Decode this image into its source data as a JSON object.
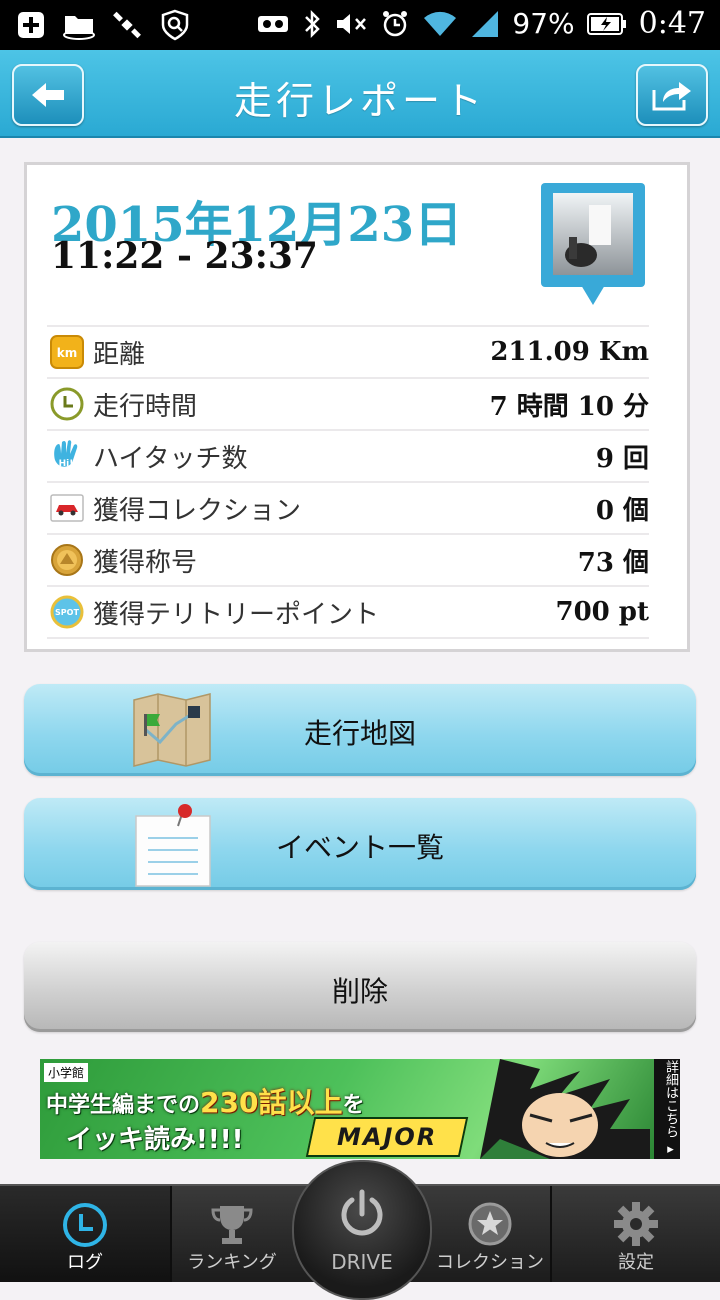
{
  "status_bar": {
    "battery": "97%",
    "time": "0:47",
    "icons": [
      "plus-icon",
      "folder-sync-icon",
      "satellite-icon",
      "security-shield-icon",
      "vr-icon",
      "bluetooth-icon",
      "mute-icon",
      "alarm-icon",
      "wifi-icon",
      "signal-icon",
      "battery-icon"
    ]
  },
  "header": {
    "title": "走行レポート",
    "back_icon": "back-arrow-icon",
    "share_icon": "share-icon"
  },
  "report": {
    "date": "2015年12月23日",
    "time_range": "11:22 - 23:37",
    "rows": [
      {
        "label": "距離",
        "value": "211.09 Km",
        "icon": "km-icon",
        "icon_text": "km"
      },
      {
        "label": "走行時間",
        "value": "7 時間 10 分",
        "icon": "clock-icon"
      },
      {
        "label": "ハイタッチ数",
        "value": "9 回",
        "icon": "hi-hand-icon",
        "icon_text": "Hi!"
      },
      {
        "label": "獲得コレクション",
        "value": "0 個",
        "icon": "car-card-icon"
      },
      {
        "label": "獲得称号",
        "value": "73 個",
        "icon": "medal-icon"
      },
      {
        "label": "獲得テリトリーポイント",
        "value": "700 pt",
        "icon": "spot-icon",
        "icon_text": "SPOT"
      }
    ]
  },
  "buttons": {
    "map": "走行地図",
    "events": "イベント一覧",
    "delete": "削除"
  },
  "ad": {
    "publisher": "小学館",
    "line1_pre": "中学生編までの",
    "line1_num": "230話以上",
    "line1_post": "を",
    "line2": "イッキ読み!!!!",
    "logo": "MAJOR",
    "info": "詳細はこちら ▸"
  },
  "tabs": {
    "log": "ログ",
    "ranking": "ランキング",
    "drive": "DRIVE",
    "collection": "コレクション",
    "settings": "設定"
  },
  "colors": {
    "header": "#2aa9d3",
    "date": "#2fa7c9",
    "button": "#8fd7ee",
    "delete": "#d0d0d0",
    "tabbar": "#1c1c1c"
  }
}
